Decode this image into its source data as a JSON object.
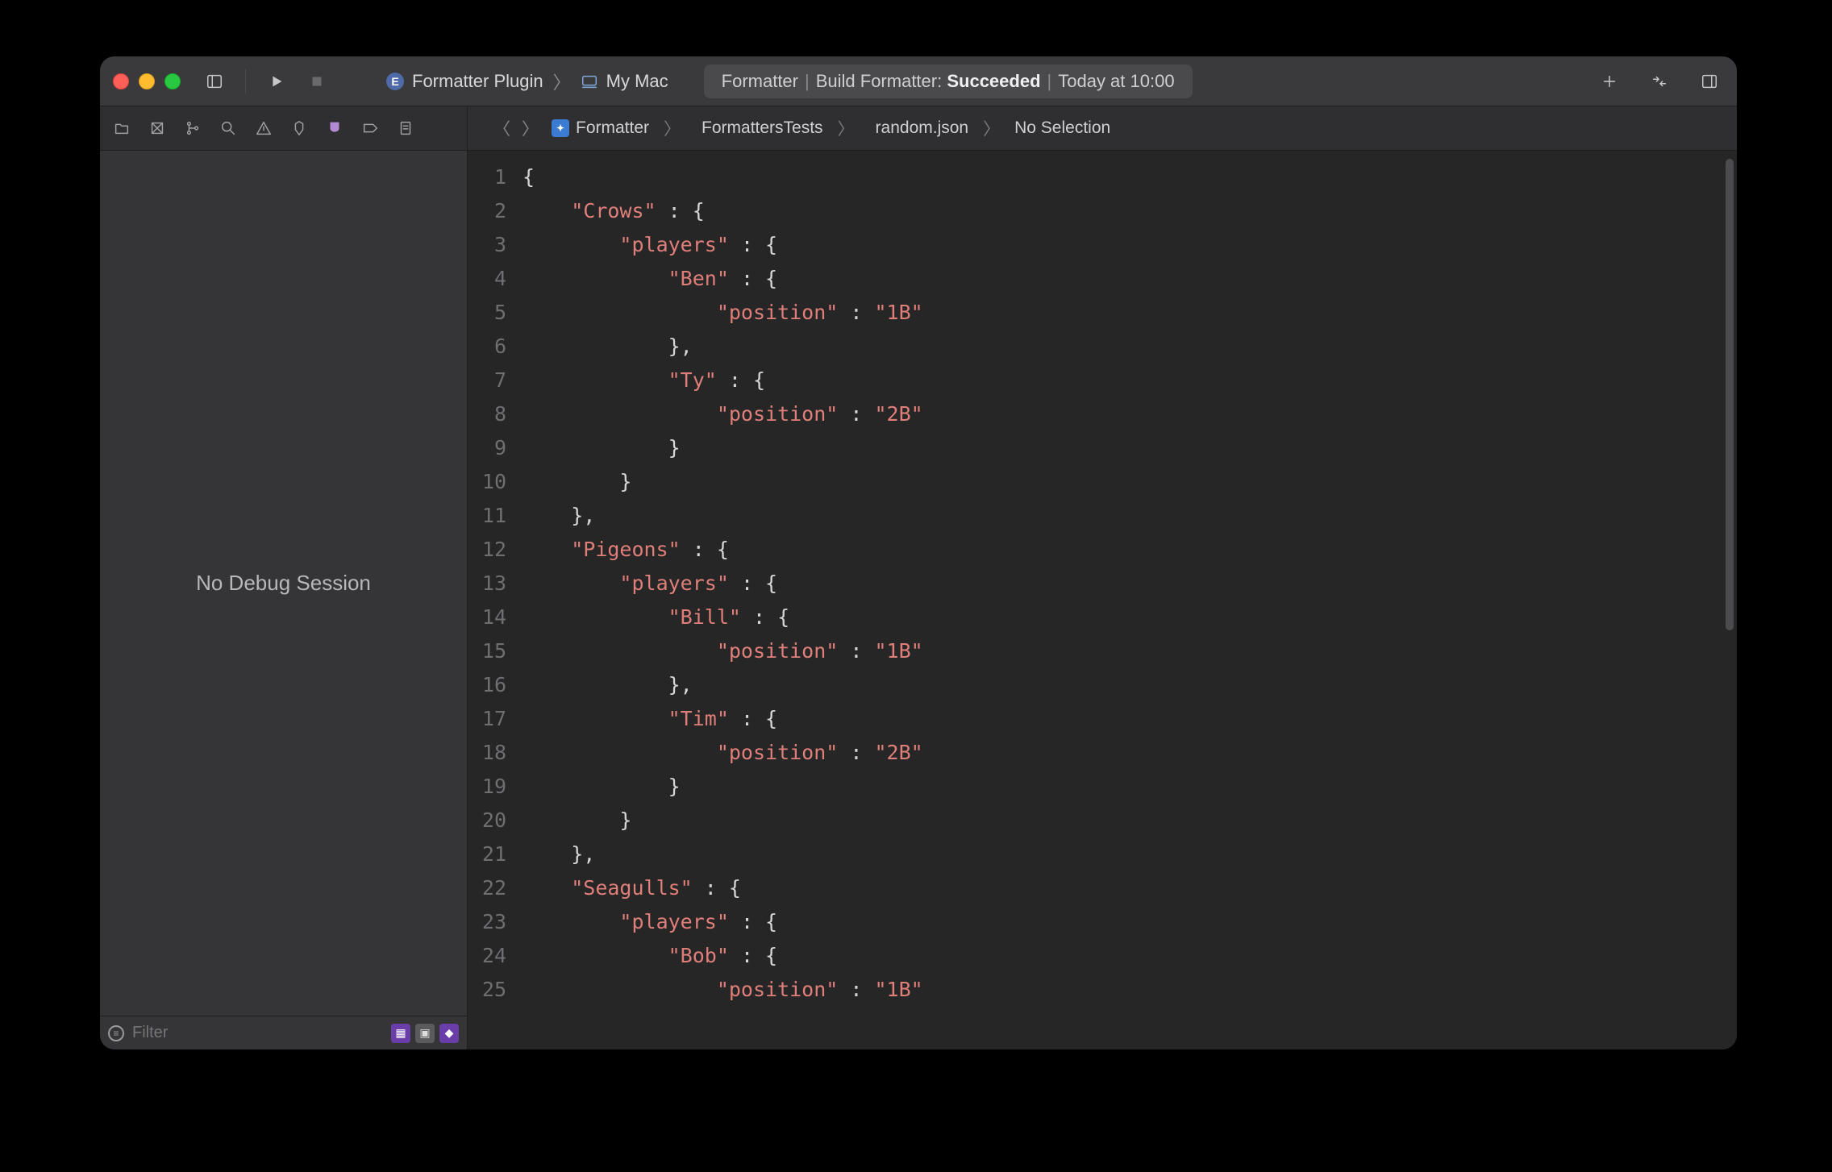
{
  "toolbar": {
    "scheme": {
      "project_name": "Formatter Plugin",
      "destination": "My Mac"
    },
    "status": {
      "target": "Formatter",
      "action": "Build Formatter:",
      "result": "Succeeded",
      "time": "Today at 10:00"
    }
  },
  "jumpbar": {
    "crumbs": [
      "Formatter",
      "FormattersTests",
      "random.json",
      "No Selection"
    ]
  },
  "sidebar": {
    "message": "No Debug Session",
    "filter_placeholder": "Filter"
  },
  "code": {
    "lines": [
      [
        {
          "t": "{",
          "c": "p"
        }
      ],
      [
        {
          "t": "    ",
          "c": "p"
        },
        {
          "t": "\"Crows\"",
          "c": "s"
        },
        {
          "t": " : {",
          "c": "p"
        }
      ],
      [
        {
          "t": "        ",
          "c": "p"
        },
        {
          "t": "\"players\"",
          "c": "s"
        },
        {
          "t": " : {",
          "c": "p"
        }
      ],
      [
        {
          "t": "            ",
          "c": "p"
        },
        {
          "t": "\"Ben\"",
          "c": "s"
        },
        {
          "t": " : {",
          "c": "p"
        }
      ],
      [
        {
          "t": "                ",
          "c": "p"
        },
        {
          "t": "\"position\"",
          "c": "s"
        },
        {
          "t": " : ",
          "c": "p"
        },
        {
          "t": "\"1B\"",
          "c": "s"
        }
      ],
      [
        {
          "t": "            },",
          "c": "p"
        }
      ],
      [
        {
          "t": "            ",
          "c": "p"
        },
        {
          "t": "\"Ty\"",
          "c": "s"
        },
        {
          "t": " : {",
          "c": "p"
        }
      ],
      [
        {
          "t": "                ",
          "c": "p"
        },
        {
          "t": "\"position\"",
          "c": "s"
        },
        {
          "t": " : ",
          "c": "p"
        },
        {
          "t": "\"2B\"",
          "c": "s"
        }
      ],
      [
        {
          "t": "            }",
          "c": "p"
        }
      ],
      [
        {
          "t": "        }",
          "c": "p"
        }
      ],
      [
        {
          "t": "    },",
          "c": "p"
        }
      ],
      [
        {
          "t": "    ",
          "c": "p"
        },
        {
          "t": "\"Pigeons\"",
          "c": "s"
        },
        {
          "t": " : {",
          "c": "p"
        }
      ],
      [
        {
          "t": "        ",
          "c": "p"
        },
        {
          "t": "\"players\"",
          "c": "s"
        },
        {
          "t": " : {",
          "c": "p"
        }
      ],
      [
        {
          "t": "            ",
          "c": "p"
        },
        {
          "t": "\"Bill\"",
          "c": "s"
        },
        {
          "t": " : {",
          "c": "p"
        }
      ],
      [
        {
          "t": "                ",
          "c": "p"
        },
        {
          "t": "\"position\"",
          "c": "s"
        },
        {
          "t": " : ",
          "c": "p"
        },
        {
          "t": "\"1B\"",
          "c": "s"
        }
      ],
      [
        {
          "t": "            },",
          "c": "p"
        }
      ],
      [
        {
          "t": "            ",
          "c": "p"
        },
        {
          "t": "\"Tim\"",
          "c": "s"
        },
        {
          "t": " : {",
          "c": "p"
        }
      ],
      [
        {
          "t": "                ",
          "c": "p"
        },
        {
          "t": "\"position\"",
          "c": "s"
        },
        {
          "t": " : ",
          "c": "p"
        },
        {
          "t": "\"2B\"",
          "c": "s"
        }
      ],
      [
        {
          "t": "            }",
          "c": "p"
        }
      ],
      [
        {
          "t": "        }",
          "c": "p"
        }
      ],
      [
        {
          "t": "    },",
          "c": "p"
        }
      ],
      [
        {
          "t": "    ",
          "c": "p"
        },
        {
          "t": "\"Seagulls\"",
          "c": "s"
        },
        {
          "t": " : {",
          "c": "p"
        }
      ],
      [
        {
          "t": "        ",
          "c": "p"
        },
        {
          "t": "\"players\"",
          "c": "s"
        },
        {
          "t": " : {",
          "c": "p"
        }
      ],
      [
        {
          "t": "            ",
          "c": "p"
        },
        {
          "t": "\"Bob\"",
          "c": "s"
        },
        {
          "t": " : {",
          "c": "p"
        }
      ],
      [
        {
          "t": "                ",
          "c": "p"
        },
        {
          "t": "\"position\"",
          "c": "s"
        },
        {
          "t": " : ",
          "c": "p"
        },
        {
          "t": "\"1B\"",
          "c": "s"
        }
      ]
    ]
  }
}
